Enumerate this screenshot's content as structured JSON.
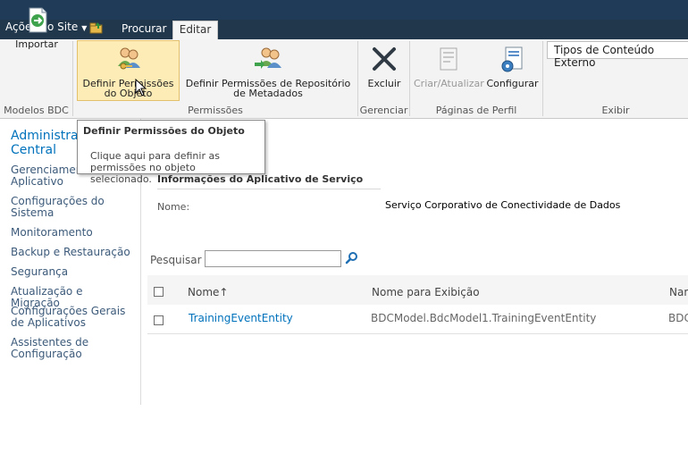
{
  "topbar": {
    "site_actions_label": "Ações do Site",
    "tabs": [
      "Procurar",
      "Editar"
    ]
  },
  "ribbon": {
    "buttons": {
      "importar": "Importar",
      "definir_permissoes_objeto": "Definir Permissões do Objeto",
      "definir_permissoes_repositorio": "Definir Permissões de Repositório de Metadados",
      "excluir": "Excluir",
      "criar_atualizar": "Criar/Atualizar",
      "configurar": "Configurar"
    },
    "groups": [
      "Modelos BDC",
      "Permissões",
      "Gerenciar",
      "Páginas de Perfil",
      "Exibir"
    ],
    "view_select_value": "Tipos de Conteúdo Externo"
  },
  "tooltip": {
    "title": "Definir Permissões do Objeto",
    "body": "Clique aqui para definir as permissões no objeto selecionado."
  },
  "leftnav": {
    "title": "Administração Central",
    "items": [
      "Gerenciamento de Aplicativo",
      "Configurações do Sistema",
      "Monitoramento",
      "Backup e Restauração",
      "Segurança",
      "Atualização e Migração",
      "Configurações Gerais de Aplicativos",
      "Assistentes de Configuração"
    ]
  },
  "main": {
    "section_title": "Informações do Aplicativo de Serviço",
    "name_label": "Nome:",
    "name_value": "Serviço Corporativo de Conectividade de Dados",
    "search_label": "Pesquisar",
    "search_value": "",
    "table": {
      "headers": [
        "Nome↑",
        "Nome para Exibição",
        "Namespace"
      ],
      "rows": [
        [
          "TrainingEventEntity",
          "BDCModel.BdcModel1.TrainingEventEntity",
          "BDCModel"
        ]
      ]
    }
  }
}
